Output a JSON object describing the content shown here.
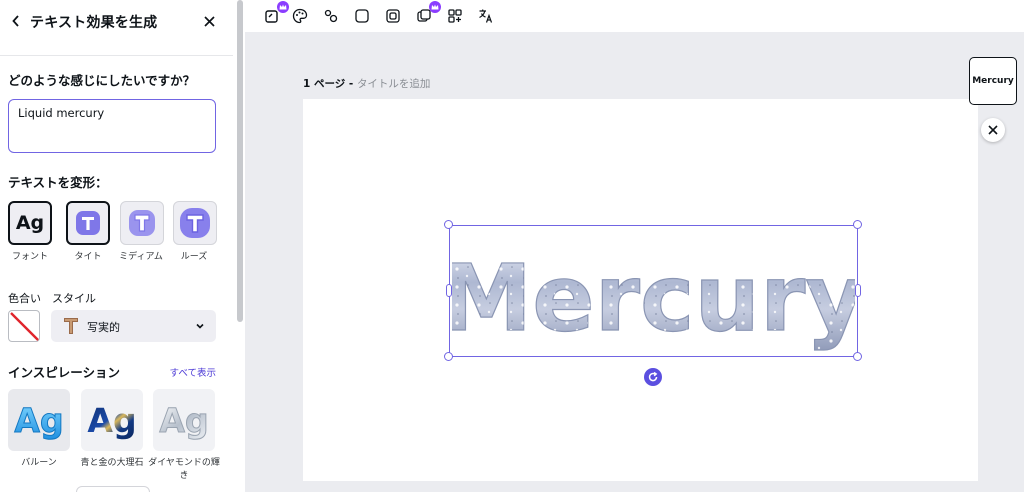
{
  "panel": {
    "title": "テキスト効果を生成",
    "question": "どのような感じにしたいですか？",
    "prompt_value": "Liquid mercury",
    "transform_label": "テキストを変形：",
    "transform_options": [
      {
        "label": "フォント",
        "glyph": "Ag",
        "selected": true
      },
      {
        "label": "タイト",
        "glyph": "T",
        "selected": false
      },
      {
        "label": "ミディアム",
        "glyph": "T",
        "selected": false
      },
      {
        "label": "ルーズ",
        "glyph": "T",
        "selected": false
      }
    ],
    "color_label": "色合い",
    "style_label": "スタイル",
    "style_value": "写実的",
    "inspiration_label": "インスピレーション",
    "see_all": "すべて表示",
    "inspirations": [
      {
        "label": "バルーン",
        "glyph": "Ag"
      },
      {
        "label": "青と金の大理石",
        "glyph": "Ag"
      },
      {
        "label": "ダイヤモンドの輝き",
        "glyph": "Ag"
      }
    ]
  },
  "toolbar": {
    "icons": [
      "magic-edit-icon",
      "palette-icon",
      "effects-icon",
      "square-icon",
      "frame-icon",
      "layers-icon",
      "grid-icon",
      "translate-icon"
    ]
  },
  "canvas": {
    "page_number": "1 ページ",
    "page_separator": " - ",
    "page_title_placeholder": "タイトルを追加",
    "text": "Mercury",
    "thumbnail_text": "Mercury"
  },
  "colors": {
    "accent": "#7165e3",
    "premium": "#8b3dff",
    "link": "#4b39d6"
  }
}
